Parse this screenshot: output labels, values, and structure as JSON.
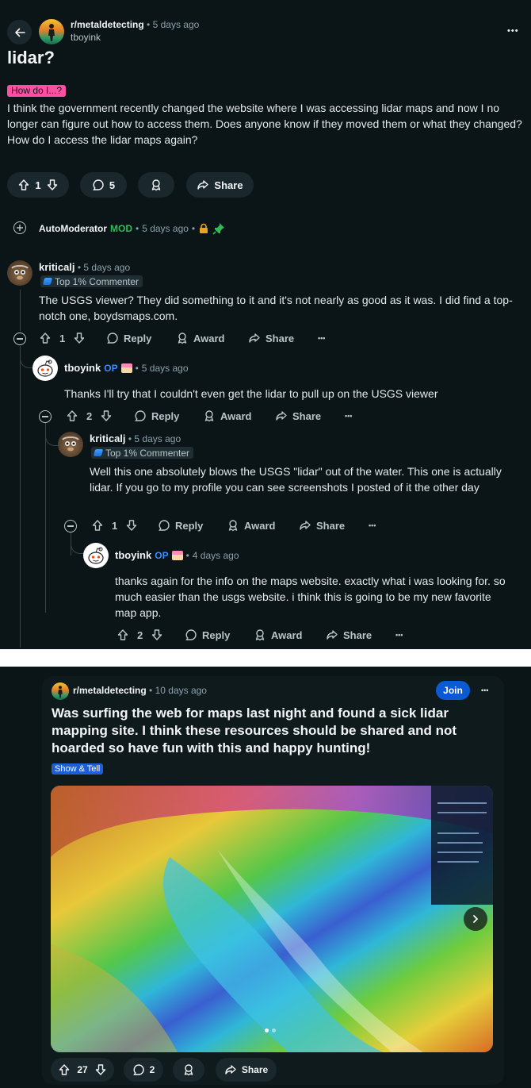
{
  "header": {
    "subreddit": "r/metaldetecting",
    "time": "5 days ago",
    "author": "tboyink",
    "more_label": "•••"
  },
  "post": {
    "title": "lidar?",
    "flair": "How do I...?",
    "body": "I think the government recently changed the website where I was accessing lidar maps and now I no longer can figure out how to access them. Does anyone know if they moved them or what they changed? How do I access the lidar maps again?",
    "votes": "1",
    "comments": "5",
    "share_label": "Share"
  },
  "automod": {
    "name": "AutoModerator",
    "tag": "MOD",
    "time": "5 days ago"
  },
  "comments": [
    {
      "author": "kriticalj",
      "time": "5 days ago",
      "badge": "Top 1% Commenter",
      "text": "The USGS viewer? They did something to it and it's not nearly as good as it was. I did find a top-notch one, boydsmaps.com.",
      "votes": "1"
    },
    {
      "author": "tboyink",
      "op": "OP",
      "time": "5 days ago",
      "text": "Thanks I'll try that I couldn't even get the lidar to pull up on the USGS viewer",
      "votes": "2"
    },
    {
      "author": "kriticalj",
      "time": "5 days ago",
      "badge": "Top 1% Commenter",
      "text": "Well this one absolutely blows the USGS \"lidar\" out of the water. This one is actually lidar. If you go to my profile you can see screenshots I posted of it the other day",
      "votes": "1"
    },
    {
      "author": "tboyink",
      "op": "OP",
      "time": "4 days ago",
      "text": "thanks again for the info on the maps website. exactly what i was looking for. so much easier than the usgs website. i think this is going to be my new favorite map app.",
      "votes": "2"
    }
  ],
  "actions": {
    "reply": "Reply",
    "award": "Award",
    "share": "Share",
    "more": "•••"
  },
  "card": {
    "subreddit": "r/metaldetecting",
    "time": "10 days ago",
    "join": "Join",
    "more": "•••",
    "title": "Was surfing the web for maps last night and found a sick lidar mapping site. I think these resources should be shared and not hoarded so have fun with this and happy hunting!",
    "flair": "Show & Tell",
    "votes": "27",
    "comments": "2",
    "share": "Share"
  },
  "colors": {
    "background": "#0b1416",
    "pill": "#1a282d",
    "flair_pink": "#ff4fa3",
    "mod_green": "#2dbd57",
    "op_blue": "#3d8bff",
    "join_blue": "#0a5ad6"
  },
  "icons": [
    "back-arrow-icon",
    "upvote-icon",
    "downvote-icon",
    "comment-icon",
    "award-icon",
    "share-icon",
    "collapse-icon",
    "expand-icon",
    "lock-icon",
    "pin-icon",
    "chevron-right-icon"
  ]
}
